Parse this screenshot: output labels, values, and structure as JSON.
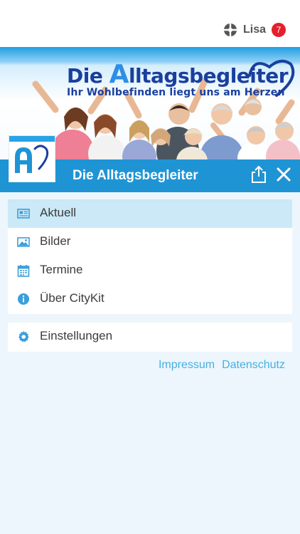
{
  "topbar": {
    "user_name": "Lisa",
    "badge_count": "7",
    "icon": "user-switch-icon"
  },
  "banner": {
    "title_part1": "Die ",
    "title_big": "A",
    "title_part2": "lltagsbegleiter",
    "subtitle": "Ihr Wohlbefinden liegt uns am Herzen"
  },
  "header": {
    "title": "Die Alltagsbegleiter",
    "share_icon": "share-icon",
    "close_icon": "close-icon"
  },
  "menu": {
    "items": [
      {
        "label": "Aktuell",
        "icon": "news-icon",
        "active": true
      },
      {
        "label": "Bilder",
        "icon": "image-icon",
        "active": false
      },
      {
        "label": "Termine",
        "icon": "calendar-icon",
        "active": false
      },
      {
        "label": "Über CityKit",
        "icon": "info-icon",
        "active": false
      }
    ],
    "settings": {
      "label": "Einstellungen",
      "icon": "gear-icon"
    }
  },
  "footer": {
    "impressum": "Impressum",
    "datenschutz": "Datenschutz"
  },
  "colors": {
    "accent": "#1f94d4",
    "active_row": "#cbe9f7",
    "icon": "#3a9fda",
    "badge": "#e4202c",
    "link": "#46b0e2"
  }
}
